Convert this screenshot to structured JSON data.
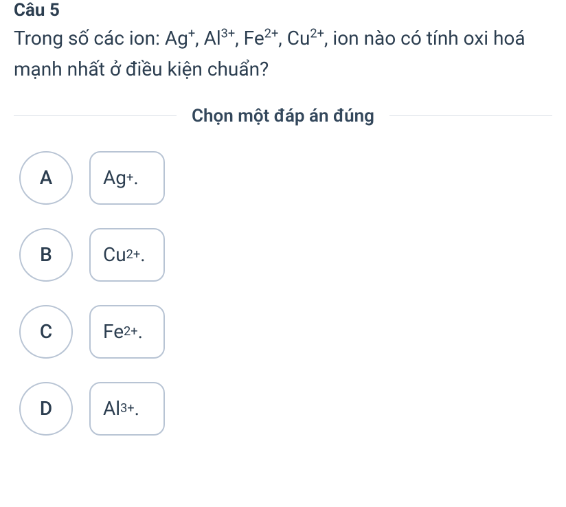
{
  "header": "Câu 5",
  "question_html": "Trong số các ion: Ag<sup>+</sup>, Al<sup>3+</sup>, Fe<sup>2+</sup>, Cu<sup>2+</sup>, ion nào có tính oxi hoá mạnh nhất ở điều kiện chuẩn?",
  "instruction": "Chọn một đáp án đúng",
  "options": [
    {
      "letter": "A",
      "label_html": "Ag<sup>+</sup>."
    },
    {
      "letter": "B",
      "label_html": "Cu<sup>2+</sup>."
    },
    {
      "letter": "C",
      "label_html": "Fe<sup>2+</sup>."
    },
    {
      "letter": "D",
      "label_html": "Al<sup>3+</sup>."
    }
  ]
}
